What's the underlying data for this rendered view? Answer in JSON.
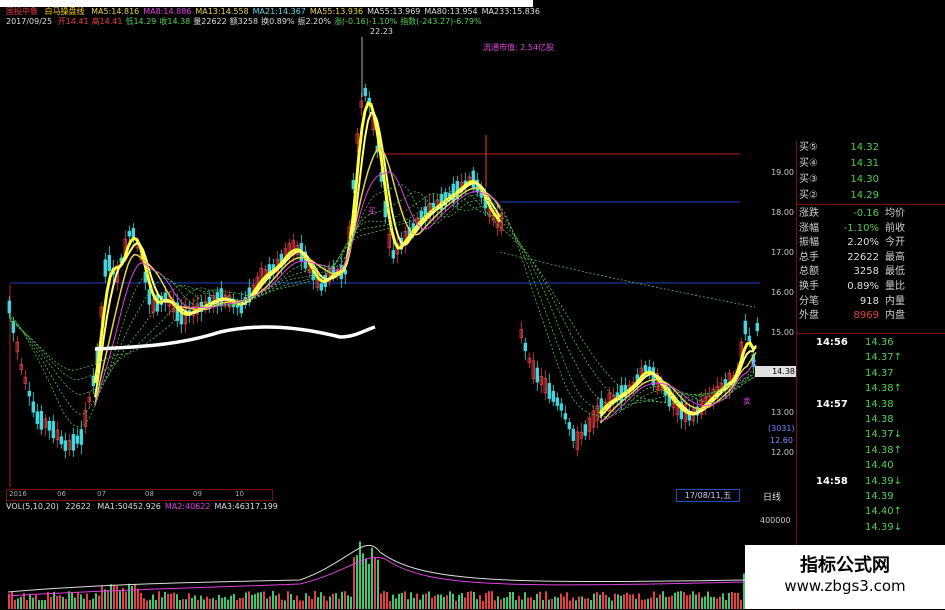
{
  "header": {
    "symbol": "国投中鲁",
    "indicator": "白马操盘线",
    "ma": [
      {
        "label": "MA5:14.816",
        "color": "#e6d34a"
      },
      {
        "label": "MA8:14.886",
        "color": "#e040e0"
      },
      {
        "label": "MA13:14.558",
        "color": "#e6d34a"
      },
      {
        "label": "MA21:14.367",
        "color": "#60d8e8"
      },
      {
        "label": "MA55:13.936",
        "color": "#e6d34a"
      },
      {
        "label": "MA55:13.969",
        "color": "#ddd"
      },
      {
        "label": "MA80:13.954",
        "color": "#ddd"
      },
      {
        "label": "MA233:15.836",
        "color": "#ddd"
      }
    ]
  },
  "quote_row": {
    "date": "2017/09/25",
    "items": [
      {
        "label": "开14.41",
        "color": "#e84040"
      },
      {
        "label": "高14.41",
        "color": "#e84040"
      },
      {
        "label": "低14.29",
        "color": "#50d050"
      },
      {
        "label": "收14.38",
        "color": "#50d050"
      },
      {
        "label": "量22622",
        "color": "#ddd"
      },
      {
        "label": "额3258",
        "color": "#ddd"
      },
      {
        "label": "换0.89%",
        "color": "#ddd"
      },
      {
        "label": "振2.20%",
        "color": "#ddd"
      },
      {
        "label": "涨(-0.16)-1.10%",
        "color": "#50d050"
      },
      {
        "label": "指数(-243.27)-6.79%",
        "color": "#50d050"
      }
    ]
  },
  "chart": {
    "peak_label": "22.23",
    "float_value_label": "流通市值: 2.54亿股",
    "buy_label": "买",
    "sell_label": "卖",
    "price_ticks": [
      "19.00",
      "18.00",
      "17.00",
      "16.00",
      "15.00",
      "14.00",
      "13.00",
      "12.00"
    ],
    "current_price": "14.38",
    "count_label": "(3031)",
    "low_label": "12.60",
    "date_ticks": [
      "2016",
      "06",
      "07",
      "08",
      "09",
      "10"
    ],
    "date_box": "17/08/11,五",
    "period_label": "日线"
  },
  "volume": {
    "label": "VOL(5,10,20)",
    "value": "22622",
    "items": [
      {
        "label": "MA1:50452.926",
        "color": "#ddd"
      },
      {
        "label": "MA2:40622",
        "color": "#e040e0"
      },
      {
        "label": "MA3:46317.199",
        "color": "#ddd"
      }
    ],
    "axis_label": "400000"
  },
  "panel": {
    "bids": [
      {
        "label": "买⑤",
        "value": "14.32"
      },
      {
        "label": "买④",
        "value": "14.31"
      },
      {
        "label": "买③",
        "value": "14.30"
      },
      {
        "label": "买②",
        "value": "14.29"
      }
    ],
    "stats": [
      {
        "label": "涨跌",
        "value": "-0.16",
        "label2": "均价",
        "color": "#50d050"
      },
      {
        "label": "涨幅",
        "value": "-1.10%",
        "label2": "前收",
        "color": "#50d050"
      },
      {
        "label": "振幅",
        "value": "2.20%",
        "label2": "今开",
        "color": "#ddd"
      },
      {
        "label": "总手",
        "value": "22622",
        "label2": "最高",
        "color": "#ddd"
      },
      {
        "label": "总额",
        "value": "3258",
        "label2": "最低",
        "color": "#ddd"
      },
      {
        "label": "换手",
        "value": "0.89%",
        "label2": "量比",
        "color": "#ddd"
      },
      {
        "label": "分笔",
        "value": "918",
        "label2": "内量",
        "color": "#ddd"
      },
      {
        "label": "外盘",
        "value": "8969",
        "label2": "内盘",
        "color": "#e84040"
      }
    ],
    "ticks": [
      {
        "time": "14:56",
        "price": "14.36"
      },
      {
        "time": "",
        "price": "14.37↑"
      },
      {
        "time": "",
        "price": "14.37"
      },
      {
        "time": "",
        "price": "14.38↑"
      },
      {
        "time": "14:57",
        "price": "14.38"
      },
      {
        "time": "",
        "price": "14.38"
      },
      {
        "time": "",
        "price": "14.37↓"
      },
      {
        "time": "",
        "price": "14.38↑"
      },
      {
        "time": "",
        "price": "14.40"
      },
      {
        "time": "14:58",
        "price": "14.39↓"
      },
      {
        "time": "",
        "price": "14.39"
      },
      {
        "time": "",
        "price": "14.40↑"
      },
      {
        "time": "",
        "price": "14.39↓"
      }
    ]
  },
  "watermark": {
    "title": "指标公式网",
    "url": "www.zbgs3.com"
  }
}
